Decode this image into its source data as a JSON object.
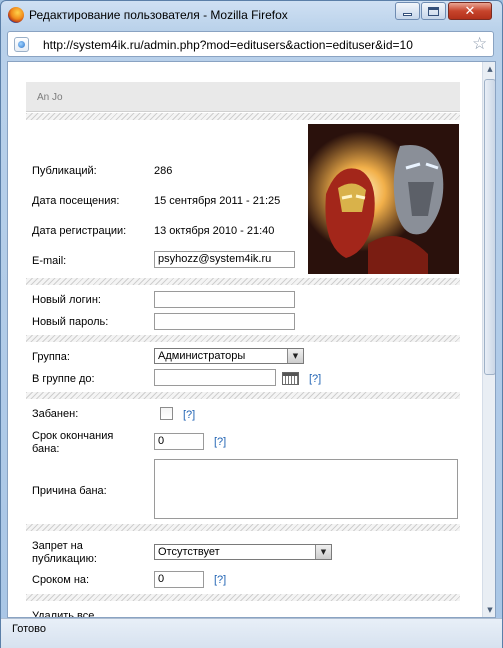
{
  "window": {
    "title": "Редактирование пользователя - Mozilla Firefox",
    "url": "http://system4ik.ru/admin.php?mod=editusers&action=edituser&id=10"
  },
  "profile": {
    "username": "An Jo",
    "publications_label": "Публикаций:",
    "publications_value": "286",
    "last_visit_label": "Дата посещения:",
    "last_visit_value": "15 сентября 2011 - 21:25",
    "registered_label": "Дата регистрации:",
    "registered_value": "13 октября 2010 - 21:40",
    "email_label": "E-mail:",
    "email_value": "psyhozz@system4ik.ru"
  },
  "credentials": {
    "new_login_label": "Новый логин:",
    "new_login_value": "",
    "new_password_label": "Новый пароль:",
    "new_password_value": ""
  },
  "group": {
    "group_label": "Группа:",
    "group_value": "Администраторы",
    "until_label": "В группе до:",
    "until_value": "",
    "help": "[?]"
  },
  "ban": {
    "banned_label": "Забанен:",
    "banned_checked": false,
    "end_label_line1": "Срок окончания",
    "end_label_line2": "бана:",
    "end_value": "0",
    "reason_label": "Причина бана:",
    "reason_value": "",
    "help": "[?]"
  },
  "publish_ban": {
    "label_line1": "Запрет на",
    "label_line2": "публикацию:",
    "value": "Отсутствует",
    "term_label": "Сроком на:",
    "term_value": "0",
    "help": "[?]"
  },
  "cut_off_label": "Удалить все",
  "status": "Готово",
  "icons": {
    "app": "firefox-icon",
    "site": "globe-icon",
    "bookmark": "star-icon",
    "calendar": "calendar-icon"
  }
}
